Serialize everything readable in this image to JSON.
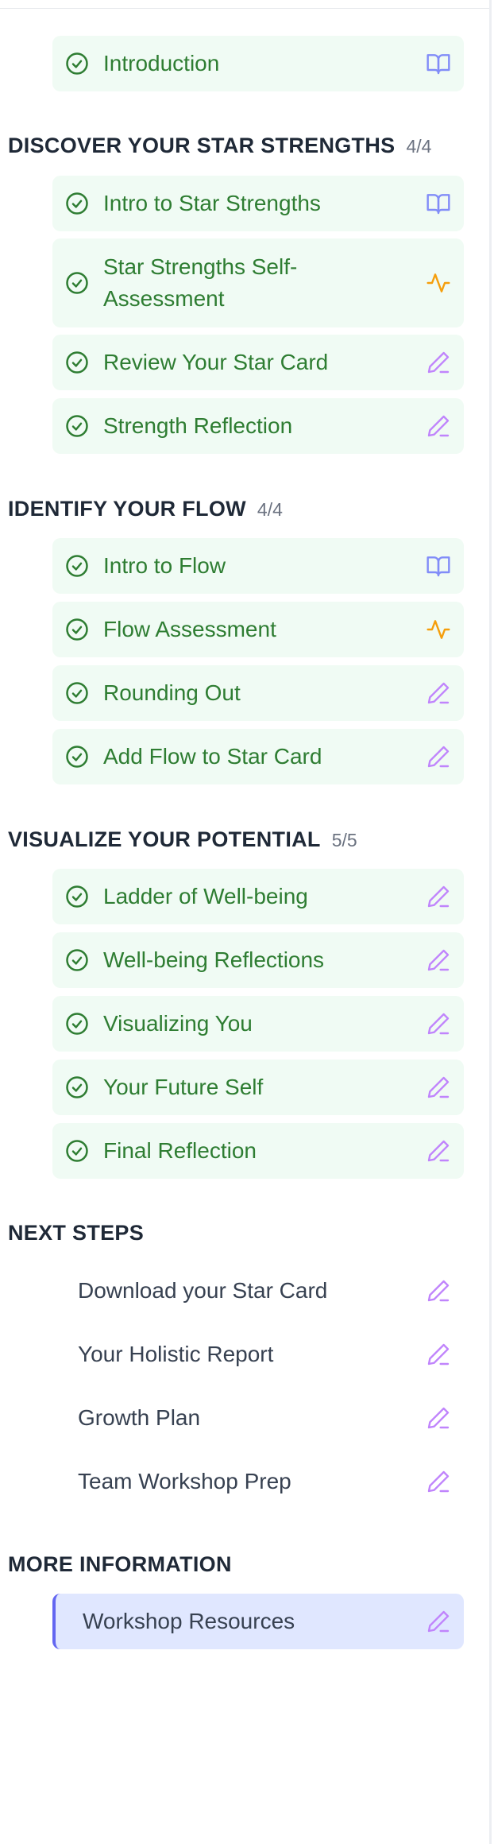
{
  "intro": {
    "label": "Introduction",
    "type_icon": "book-icon"
  },
  "sections": [
    {
      "title": "DISCOVER YOUR STAR STRENGTHS",
      "progress": "4/4",
      "items": [
        {
          "label": "Intro to Star Strengths",
          "type_icon": "book-icon"
        },
        {
          "label": "Star Strengths Self-Assessment",
          "type_icon": "activity-icon"
        },
        {
          "label": "Review Your Star Card",
          "type_icon": "pencil-icon"
        },
        {
          "label": "Strength Reflection",
          "type_icon": "pencil-icon"
        }
      ]
    },
    {
      "title": "IDENTIFY YOUR FLOW",
      "progress": "4/4",
      "items": [
        {
          "label": "Intro to Flow",
          "type_icon": "book-icon"
        },
        {
          "label": "Flow Assessment",
          "type_icon": "activity-icon"
        },
        {
          "label": "Rounding Out",
          "type_icon": "pencil-icon"
        },
        {
          "label": "Add Flow to Star Card",
          "type_icon": "pencil-icon"
        }
      ]
    },
    {
      "title": "VISUALIZE YOUR POTENTIAL",
      "progress": "5/5",
      "items": [
        {
          "label": "Ladder of Well-being",
          "type_icon": "pencil-icon"
        },
        {
          "label": "Well-being Reflections",
          "type_icon": "pencil-icon"
        },
        {
          "label": "Visualizing You",
          "type_icon": "pencil-icon"
        },
        {
          "label": "Your Future Self",
          "type_icon": "pencil-icon"
        },
        {
          "label": "Final Reflection",
          "type_icon": "pencil-icon"
        }
      ]
    },
    {
      "title": "NEXT STEPS",
      "items": [
        {
          "label": "Download your Star Card",
          "type_icon": "pencil-icon"
        },
        {
          "label": "Your Holistic Report",
          "type_icon": "pencil-icon"
        },
        {
          "label": "Growth Plan",
          "type_icon": "pencil-icon"
        },
        {
          "label": "Team Workshop Prep",
          "type_icon": "pencil-icon"
        }
      ]
    },
    {
      "title": "MORE INFORMATION",
      "items": [
        {
          "label": "Workshop Resources",
          "type_icon": "pencil-icon",
          "active": true
        }
      ]
    }
  ],
  "colors": {
    "completed_bg": "#f0fbf4",
    "completed_text": "#2e7d32",
    "check_icon": "#2e7d32",
    "book_icon": "#818cf8",
    "activity_icon": "#f59e0b",
    "pencil_icon": "#c084fc",
    "active_bg": "#e0e7ff",
    "active_border": "#6366f1"
  }
}
